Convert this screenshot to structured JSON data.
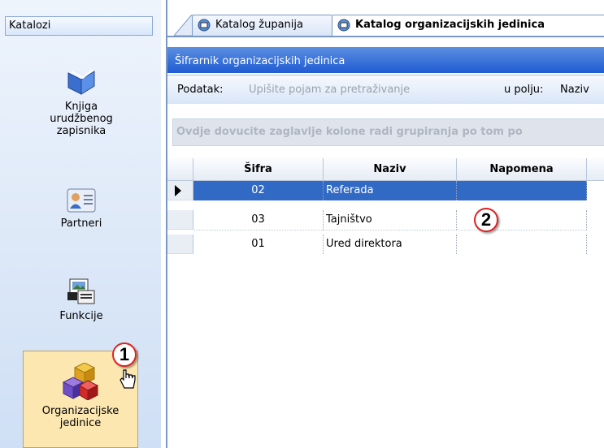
{
  "sidebar": {
    "header": "Katalozi",
    "items": [
      {
        "label": "Knjiga urudžbenog zapisnika",
        "icon": "book-icon"
      },
      {
        "label": "Partneri",
        "icon": "contact-card-icon"
      },
      {
        "label": "Funkcije",
        "icon": "document-projector-icon"
      },
      {
        "label": "Organizacijske jedinice",
        "icon": "shapes-icon",
        "selected": true
      }
    ]
  },
  "tabs": [
    {
      "label": "Katalog županija",
      "active": false
    },
    {
      "label": "Katalog organizacijskih jedinica",
      "active": true
    }
  ],
  "panel": {
    "title": "Šifrarnik organizacijskih jedinica",
    "search_label": "Podatak:",
    "search_placeholder": "Upišite pojam za pretraživanje",
    "field_label": "u polju:",
    "field_value": "Naziv",
    "group_hint": "Ovdje dovucite zaglavlje kolone radi grupiranja po tom po"
  },
  "grid": {
    "columns": [
      "Šifra",
      "Naziv",
      "Napomena"
    ],
    "rows": [
      {
        "sifra": "02",
        "naziv": "Referada",
        "napomena": ""
      },
      {
        "sifra": "03",
        "naziv": "Tajništvo",
        "napomena": ""
      },
      {
        "sifra": "01",
        "naziv": "Ured direktora",
        "napomena": ""
      }
    ]
  },
  "callouts": [
    "1",
    "2"
  ],
  "colors": {
    "selection": "#316ac5",
    "panel_title": "#1f5bd3",
    "selected_sidebar": "#fce7b1"
  }
}
